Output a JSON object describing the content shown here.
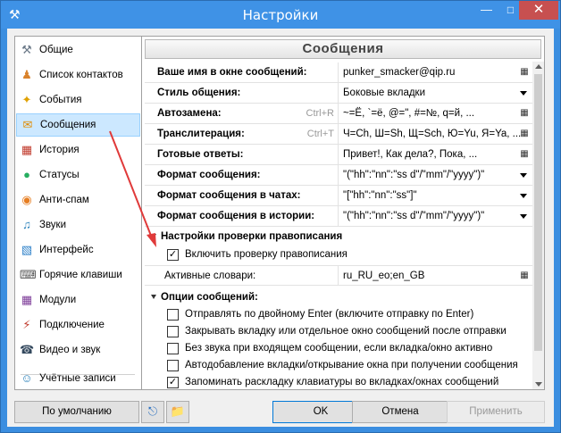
{
  "window": {
    "title": "Настройки"
  },
  "sidebar": {
    "items": [
      {
        "label": "Общие",
        "icon": "wrench-icon"
      },
      {
        "label": "Список контактов",
        "icon": "contacts-icon"
      },
      {
        "label": "События",
        "icon": "events-icon"
      },
      {
        "label": "Сообщения",
        "icon": "messages-icon",
        "active": true
      },
      {
        "label": "История",
        "icon": "calendar-icon"
      },
      {
        "label": "Статусы",
        "icon": "status-icon"
      },
      {
        "label": "Анти-спам",
        "icon": "antispam-icon"
      },
      {
        "label": "Звуки",
        "icon": "note-icon"
      },
      {
        "label": "Интерфейс",
        "icon": "interface-icon"
      },
      {
        "label": "Горячие клавиши",
        "icon": "keyboard-icon"
      },
      {
        "label": "Модули",
        "icon": "modules-icon"
      },
      {
        "label": "Подключение",
        "icon": "plug-icon"
      },
      {
        "label": "Видео и звук",
        "icon": "headset-icon"
      },
      {
        "label": "Учётные записи",
        "icon": "accounts-icon"
      }
    ]
  },
  "panel": {
    "header": "Сообщения",
    "rows": [
      {
        "label": "Ваше имя в окне сообщений:",
        "value": "punker_smacker@qip.ru",
        "shortcut": "",
        "control": "edit"
      },
      {
        "label": "Стиль общения:",
        "value": "Боковые вкладки",
        "shortcut": "",
        "control": "dropdown"
      },
      {
        "label": "Автозамена:",
        "value": "~=Ё, `=ё, @=\", #=№, q=й, ...",
        "shortcut": "Ctrl+R",
        "control": "edit"
      },
      {
        "label": "Транслитерация:",
        "value": "Ч=Ch, Ш=Sh, Щ=Sch, Ю=Yu, Я=Ya, ...",
        "shortcut": "Ctrl+T",
        "control": "edit"
      },
      {
        "label": "Готовые ответы:",
        "value": "Привет!, Как дела?, Пока, ...",
        "shortcut": "",
        "control": "edit"
      },
      {
        "label": "Формат сообщения:",
        "value": "\"(\"hh\":\"nn\":\"ss d\"/\"mm\"/\"yyyy\")\"",
        "shortcut": "",
        "control": "dropdown"
      },
      {
        "label": "Формат сообщения в чатах:",
        "value": "\"[\"hh\":\"nn\":\"ss\"]\"",
        "shortcut": "",
        "control": "dropdown"
      },
      {
        "label": "Формат сообщения в истории:",
        "value": "\"(\"hh\":\"nn\":\"ss d\"/\"mm\"/\"yyyy\")\"",
        "shortcut": "",
        "control": "dropdown"
      }
    ],
    "spell_section": {
      "title": "Настройки проверки правописания",
      "enable_label": "Включить проверку правописания",
      "enable_checked": true,
      "dict_label": "Активные словари:",
      "dict_value": "ru_RU_eo;en_GB"
    },
    "options_section": {
      "title": "Опции сообщений:",
      "items": [
        {
          "label": "Отправлять по двойному Enter (включите отправку по Enter)",
          "checked": false
        },
        {
          "label": "Закрывать вкладку или отдельное окно сообщений после отправки",
          "checked": false
        },
        {
          "label": "Без звука при входящем сообщении, если вкладка/окно активно",
          "checked": false
        },
        {
          "label": "Автодобавление вкладки/открывание окна при получении сообщения",
          "checked": false
        },
        {
          "label": "Запоминать раскладку клавиатуры во вкладках/окнах сообщений",
          "checked": true
        }
      ]
    }
  },
  "buttons": {
    "default": "По умолчанию",
    "ok": "OK",
    "cancel": "Отмена",
    "apply": "Применить"
  },
  "colors": {
    "titlebar": "#3f92e6",
    "close": "#c75050",
    "selection": "#cce8ff",
    "annotation_arrow": "#e03a3a"
  }
}
